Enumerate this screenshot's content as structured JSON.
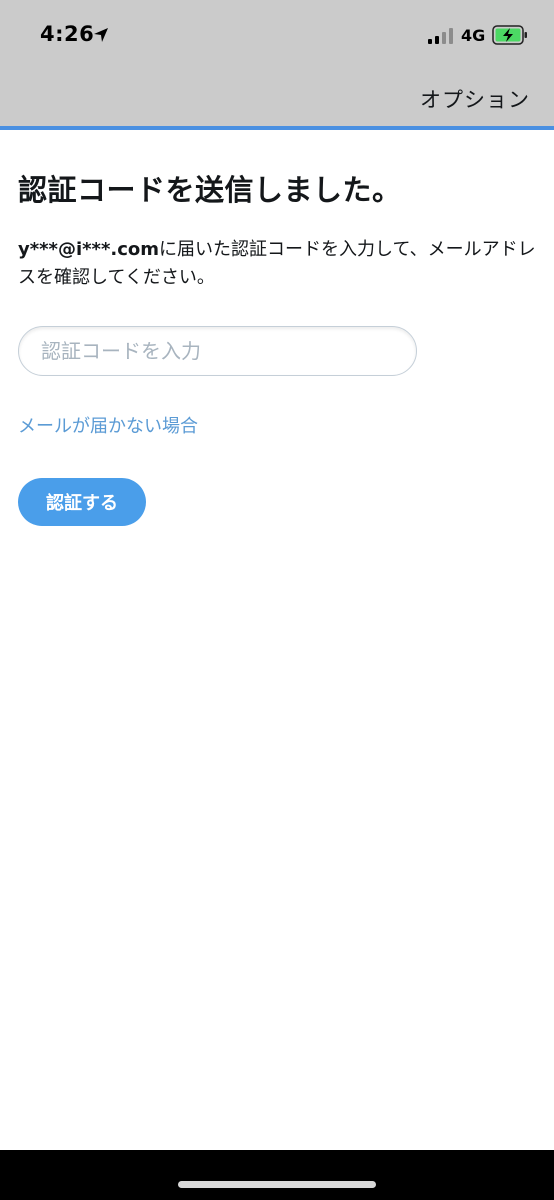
{
  "status_bar": {
    "time": "4:26",
    "network": "4G",
    "icons": [
      "location-arrow-icon",
      "signal-icon",
      "battery-charging-icon"
    ]
  },
  "nav": {
    "options_label": "オプション"
  },
  "colors": {
    "accent": "#4a90e2",
    "button": "#4a9eea",
    "link": "#5b9bd5",
    "header_bg": "#cbcbcb",
    "battery_fill": "#4cd964"
  },
  "main": {
    "title": "認証コードを送信しました。",
    "email": "y***@i***.com",
    "description_rest": "に届いた認証コードを入力して、メールアドレスを確認してください。",
    "code_input": {
      "value": "",
      "placeholder": "認証コードを入力"
    },
    "help_link": "メールが届かない場合",
    "verify_button": "認証する"
  }
}
